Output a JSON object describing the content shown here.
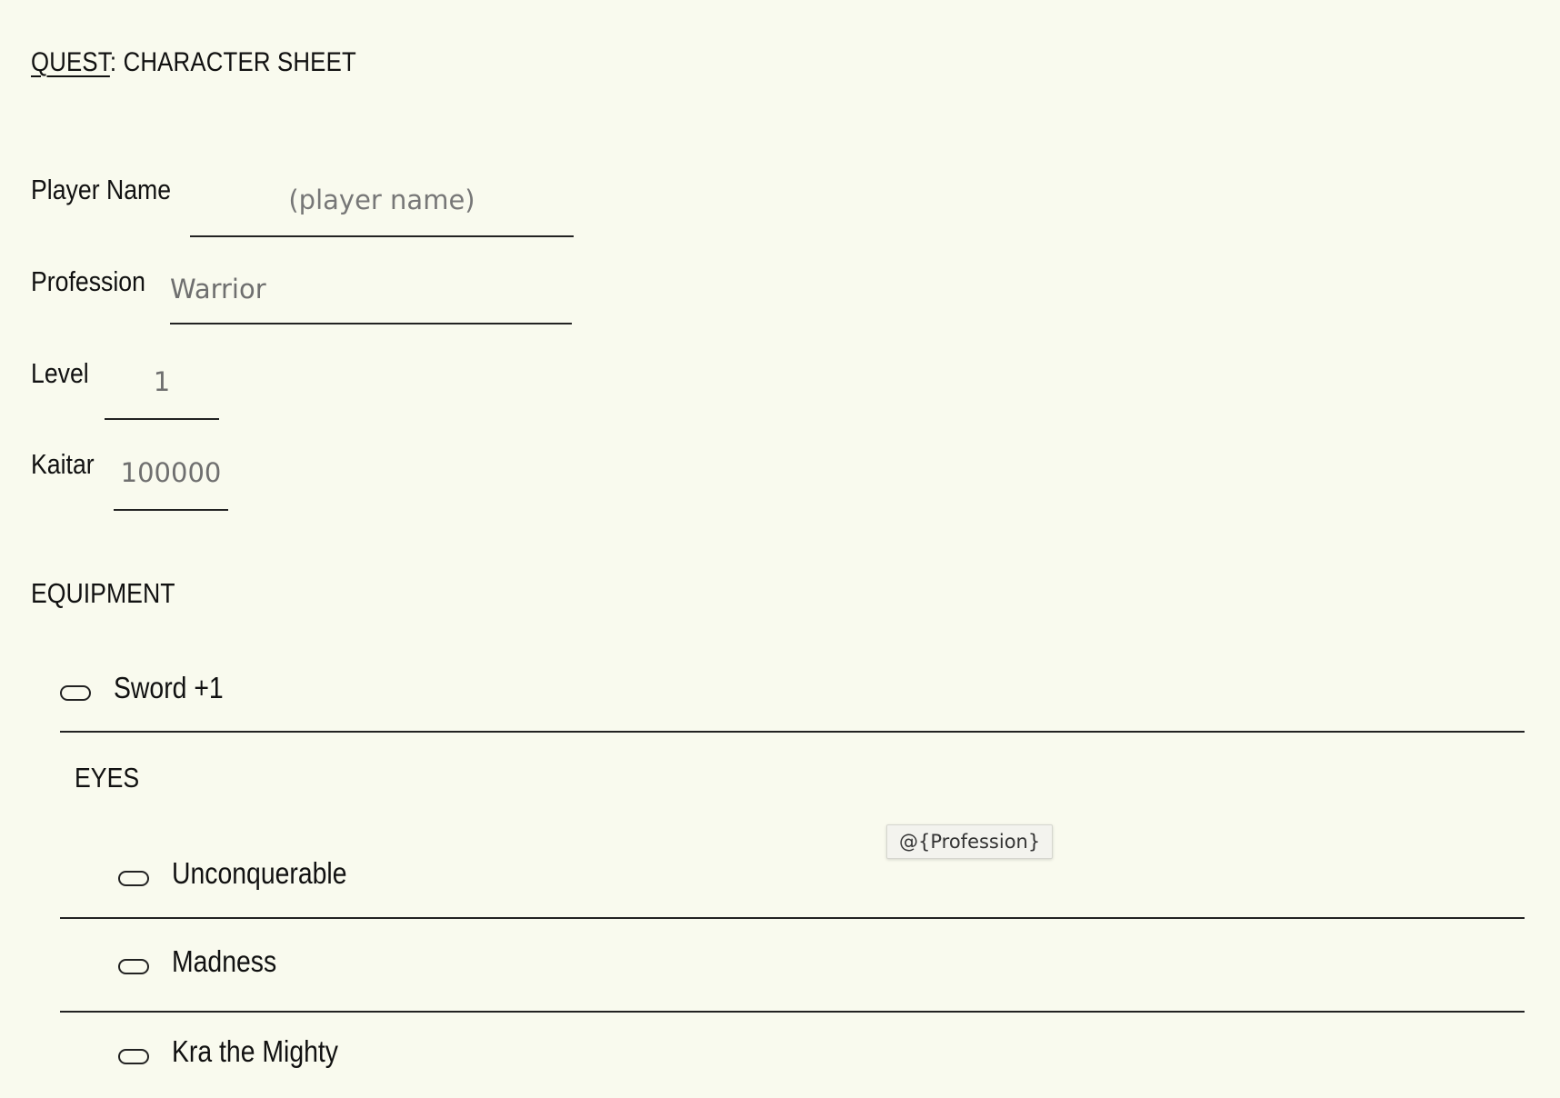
{
  "header": {
    "title_prefix": "QUEST",
    "title_rest": ": CHARACTER SHEET"
  },
  "fields": {
    "player_name": {
      "label": "Player Name",
      "value": "",
      "placeholder": "(player name)"
    },
    "profession": {
      "label": "Profession",
      "value": "Warrior",
      "placeholder": ""
    },
    "level": {
      "label": "Level",
      "value": "1",
      "placeholder": ""
    },
    "kaitar": {
      "label": "Kaitar",
      "value": "100000",
      "placeholder": ""
    }
  },
  "equipment": {
    "heading": "EQUIPMENT",
    "items": [
      {
        "label": "Sword +1",
        "checked": false
      }
    ]
  },
  "eyes": {
    "heading": "EYES",
    "items": [
      {
        "label": "Unconquerable",
        "checked": false
      },
      {
        "label": "Madness",
        "checked": false
      },
      {
        "label": "Kra the Mighty",
        "checked": false
      }
    ]
  },
  "tooltip": {
    "text": "@{Profession}"
  },
  "colors": {
    "background": "#f9faee",
    "text": "#111111",
    "input_text": "#6f6f6f",
    "rule": "#222222"
  }
}
